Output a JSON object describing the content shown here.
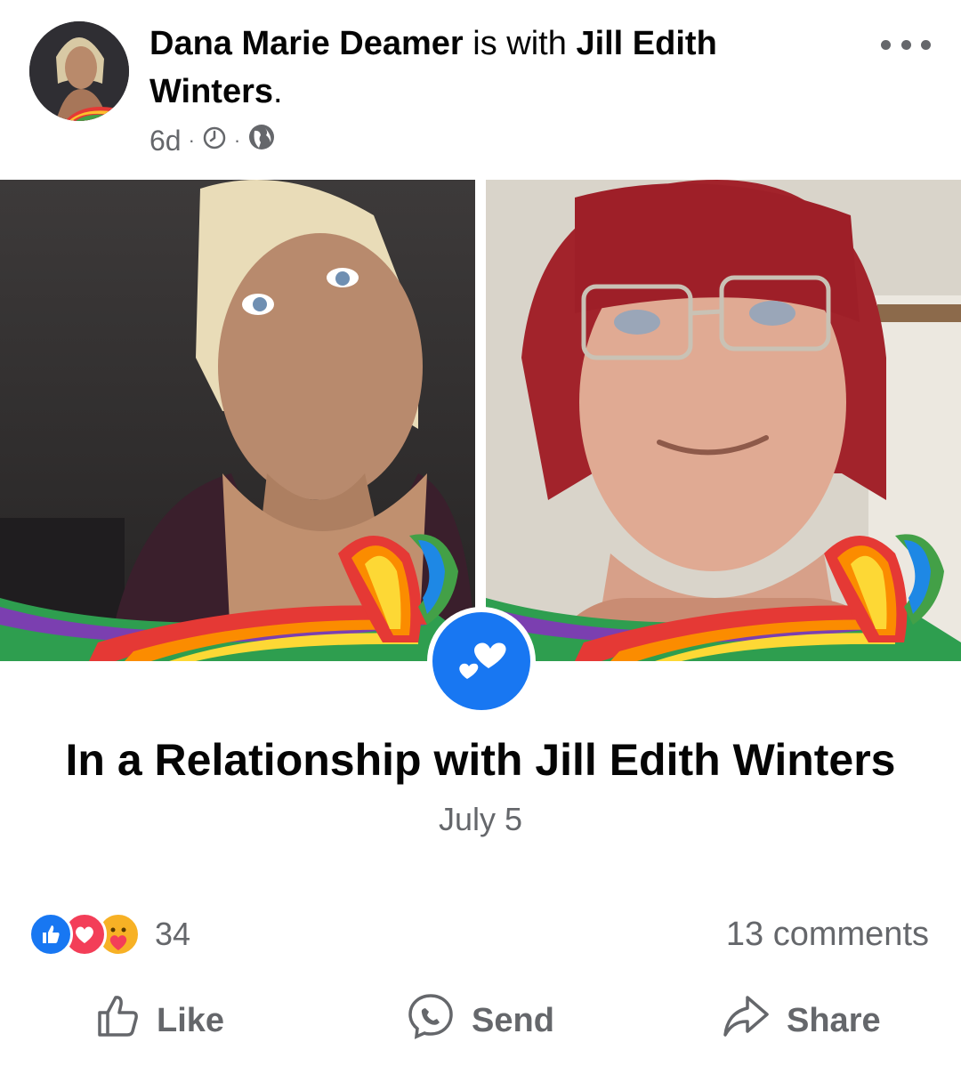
{
  "post": {
    "author": "Dana Marie Deamer",
    "with_text": "is with",
    "tagged_first": "Jill Edith",
    "tagged_second": "Winters",
    "period": ".",
    "time_ago": "6d",
    "separator": "·"
  },
  "icons": {
    "more": "more-dots-icon",
    "clock": "clock-icon",
    "globe": "globe-icon",
    "heart_badge": "hearts-icon",
    "like": "thumbs-up-icon",
    "send": "messenger-icon",
    "share": "share-arrow-icon"
  },
  "life_event": {
    "title": "In a Relationship with Jill Edith Winters",
    "date": "July 5"
  },
  "engagement": {
    "reactions": [
      "like",
      "love",
      "care"
    ],
    "reaction_count": "34",
    "comments": "13 comments"
  },
  "actions": {
    "like": "Like",
    "send": "Send",
    "share": "Share"
  },
  "colors": {
    "facebook_blue": "#1877f2",
    "secondary_text": "#65676b",
    "love_red": "#f33e58",
    "care_yellow": "#f7b125"
  }
}
